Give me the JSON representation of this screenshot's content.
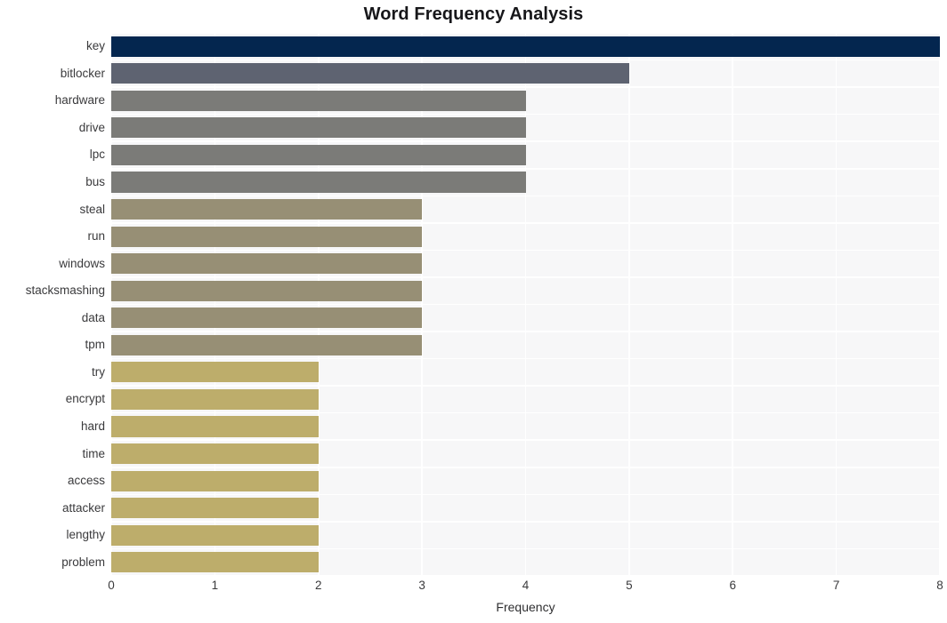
{
  "chart_data": {
    "type": "bar",
    "orientation": "horizontal",
    "title": "Word Frequency Analysis",
    "xlabel": "Frequency",
    "ylabel": "",
    "xlim": [
      0,
      8
    ],
    "xticks": [
      0,
      1,
      2,
      3,
      4,
      5,
      6,
      7,
      8
    ],
    "xtick_labels": [
      "0",
      "1",
      "2",
      "3",
      "4",
      "5",
      "6",
      "7",
      "8"
    ],
    "grid": true,
    "legend": "none",
    "categories": [
      "key",
      "bitlocker",
      "hardware",
      "drive",
      "lpc",
      "bus",
      "steal",
      "run",
      "windows",
      "stacksmashing",
      "data",
      "tpm",
      "try",
      "encrypt",
      "hard",
      "time",
      "access",
      "attacker",
      "lengthy",
      "problem"
    ],
    "values": [
      8,
      5,
      4,
      4,
      4,
      4,
      3,
      3,
      3,
      3,
      3,
      3,
      2,
      2,
      2,
      2,
      2,
      2,
      2,
      2
    ],
    "bar_colors": [
      "#04264f",
      "#5e6371",
      "#7b7b78",
      "#7b7b78",
      "#7b7b78",
      "#7b7b78",
      "#978f75",
      "#978f75",
      "#978f75",
      "#978f75",
      "#978f75",
      "#978f75",
      "#bdad6b",
      "#bdad6b",
      "#bdad6b",
      "#bdad6b",
      "#bdad6b",
      "#bdad6b",
      "#bdad6b",
      "#bdad6b"
    ]
  },
  "style": {
    "figure_background": "#ffffff",
    "panel_background": "#f7f7f8",
    "gridline_color": "#ffffff",
    "title_color": "#17171a",
    "tick_label_color": "#3a3a3c"
  }
}
